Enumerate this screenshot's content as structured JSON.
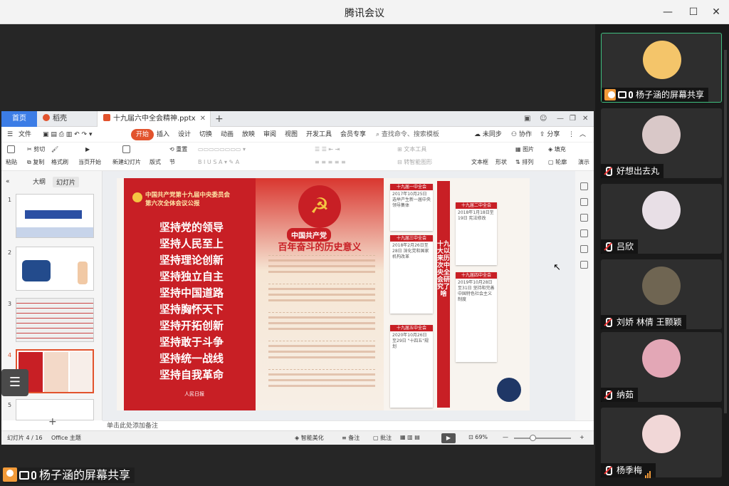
{
  "window": {
    "title": "腾讯会议"
  },
  "ppt": {
    "tabs": {
      "home": "首页",
      "docer": "稻壳",
      "file": "十九届六中全会精神.pptx"
    },
    "menus": [
      "文件",
      "开始",
      "插入",
      "设计",
      "切换",
      "动画",
      "放映",
      "审阅",
      "视图",
      "开发工具",
      "会员专享"
    ],
    "active_menu": "开始",
    "search": "查找命令、搜索模板",
    "sync": "未同步",
    "collab": "协作",
    "share": "分享",
    "ribbon": {
      "paste": "粘贴",
      "cut": "剪切",
      "copy": "复制",
      "format_painter": "格式刷",
      "from_current": "当页开始",
      "new_slide": "新建幻灯片",
      "layout": "版式",
      "section": "节",
      "reset": "重置",
      "text_box": "文本框",
      "shape": "形状",
      "arrange": "排列",
      "image": "图片",
      "fill": "填充",
      "outline": "轮廓",
      "text_tool": "文本工具",
      "smart_shape": "转智能图形",
      "review": "演示"
    },
    "left_panel": {
      "outline": "大纲",
      "slides": "幻灯片"
    },
    "thumb_numbers": [
      "1",
      "2",
      "3",
      "4",
      "5"
    ],
    "slide": {
      "header": [
        "中国共产党第十九届中央委员会",
        "第六次全体会议公报"
      ],
      "lines": [
        "坚持党的领导",
        "坚持人民至上",
        "坚持理论创新",
        "坚持独立自主",
        "坚持中国道路",
        "坚持胸怀天下",
        "坚持开拓创新",
        "坚持敢于斗争",
        "坚持统一战线",
        "坚持自我革命"
      ],
      "logo": "人民日报",
      "mid_tag": "中国共产党",
      "mid_title": "百年奋斗的历史意义",
      "vertical_title": "十九大以来历次中央全会研究了啥",
      "cards": [
        {
          "head": "十九届一中全会",
          "text": "2017年10月25日 选举产生新一届中央领导集体"
        },
        {
          "head": "十九届二中全会",
          "text": "2018年1月18日至19日 宪法修改"
        },
        {
          "head": "十九届三中全会",
          "text": "2018年2月26日至28日 深化党和国家机构改革"
        },
        {
          "head": "十九届四中全会",
          "text": "2019年10月28日至31日 坚持和完善中国特色社会主义制度"
        },
        {
          "head": "十九届五中全会",
          "text": "2020年10月26日至29日 \"十四五\"规划"
        }
      ]
    },
    "notes": "单击此处添加备注",
    "status": {
      "slide_count": "幻灯片 4 / 16",
      "theme": "Office 主题",
      "smart_beautify": "智能美化",
      "notes_btn": "备注",
      "comments": "批注",
      "zoom": "69%"
    }
  },
  "share_label": "杨子涵的屏幕共享",
  "participants": [
    {
      "name": "杨子涵的屏幕共享",
      "avatar_color": "#f4c56a",
      "selected": true
    },
    {
      "name": "好想出去丸",
      "avatar_color": "#d9c8c8"
    },
    {
      "name": "吕欣",
      "avatar_color": "#e8dfe6"
    },
    {
      "name": "刘娇 林倩 王颢颖",
      "avatar_color": "#6f6552"
    },
    {
      "name": "纳茹",
      "avatar_color": "#e3a7b6"
    },
    {
      "name": "杨季梅",
      "avatar_color": "#f1d7d7"
    }
  ],
  "colors": {
    "accent": "#e2532d",
    "party_red": "#c81f25",
    "meeting_green": "#3fbf7f"
  }
}
